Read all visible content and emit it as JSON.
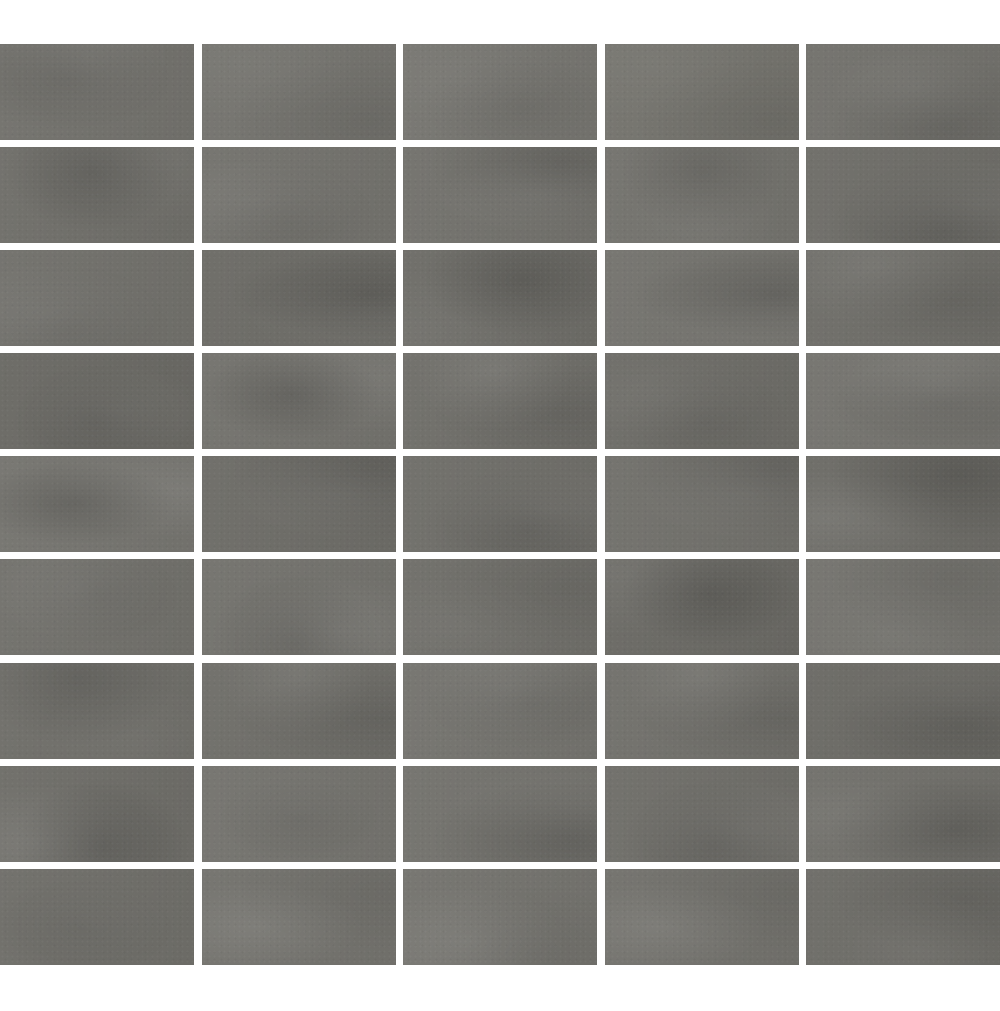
{
  "grout_color": "#ffffff",
  "tile_colors": [
    [
      "#72716c",
      "#74736e",
      "#767570",
      "#74736d",
      "#72716c"
    ],
    [
      "#6f6e69",
      "#73726d",
      "#72716c",
      "#73726d",
      "#6e6d68"
    ],
    [
      "#71706b",
      "#6c6b66",
      "#6d6c67",
      "#74736e",
      "#6e6d68"
    ],
    [
      "#6a6964",
      "#73726d",
      "#6f6e69",
      "#6d6c67",
      "#74736e"
    ],
    [
      "#75746f",
      "#6d6c67",
      "#6f6e69",
      "#71706b",
      "#6c6b66"
    ],
    [
      "#71706b",
      "#73726d",
      "#6f6e69",
      "#6a6964",
      "#74736e"
    ],
    [
      "#6f6e69",
      "#6f6e69",
      "#74736e",
      "#71706b",
      "#6b6a65"
    ],
    [
      "#6e6d68",
      "#74736e",
      "#73726d",
      "#6f6e69",
      "#71706b"
    ],
    [
      "#6f6e69",
      "#73726d",
      "#74736e",
      "#72716c",
      "#6d6c67"
    ]
  ]
}
